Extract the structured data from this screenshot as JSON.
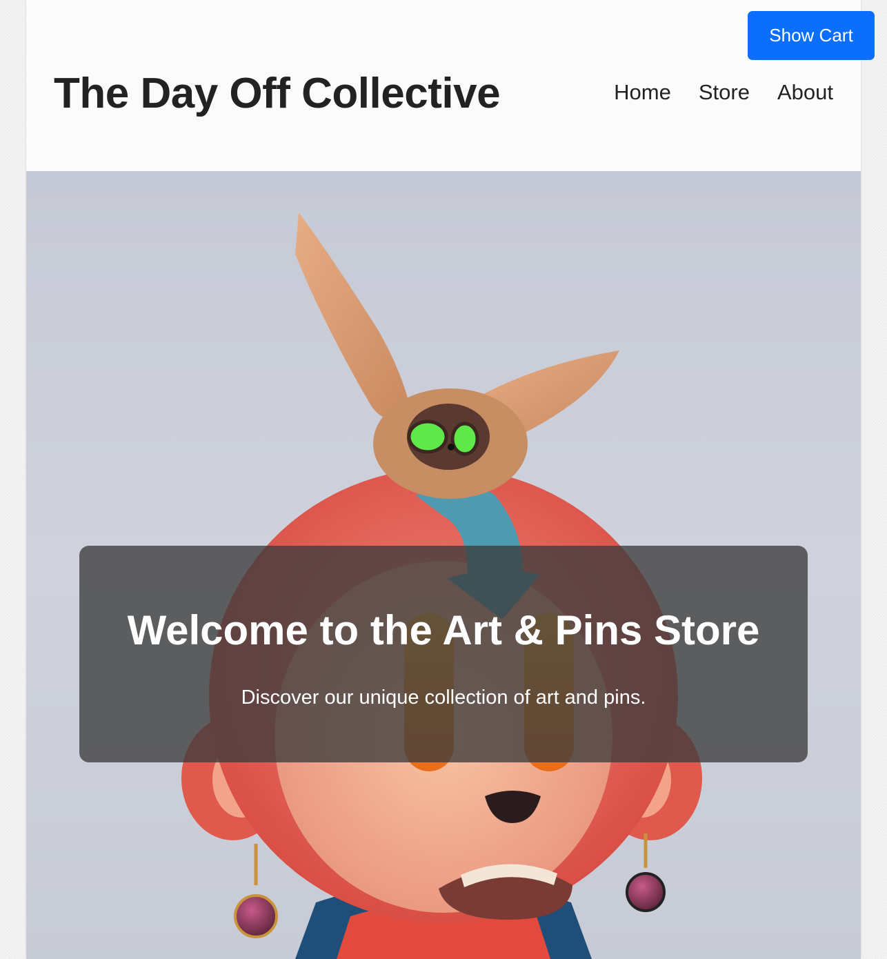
{
  "header": {
    "site_title": "The Day Off Collective",
    "nav": [
      {
        "label": "Home"
      },
      {
        "label": "Store"
      },
      {
        "label": "About"
      }
    ]
  },
  "cart_button": {
    "label": "Show Cart",
    "color": "#0b6efd"
  },
  "hero": {
    "title": "Welcome to the Art & Pins Store",
    "subtitle": "Discover our unique collection of art and pins.",
    "image_subject": "3D red monkey character with glowing eyes and earrings, with a long-eared furry creature with green eyes perched on its head"
  }
}
